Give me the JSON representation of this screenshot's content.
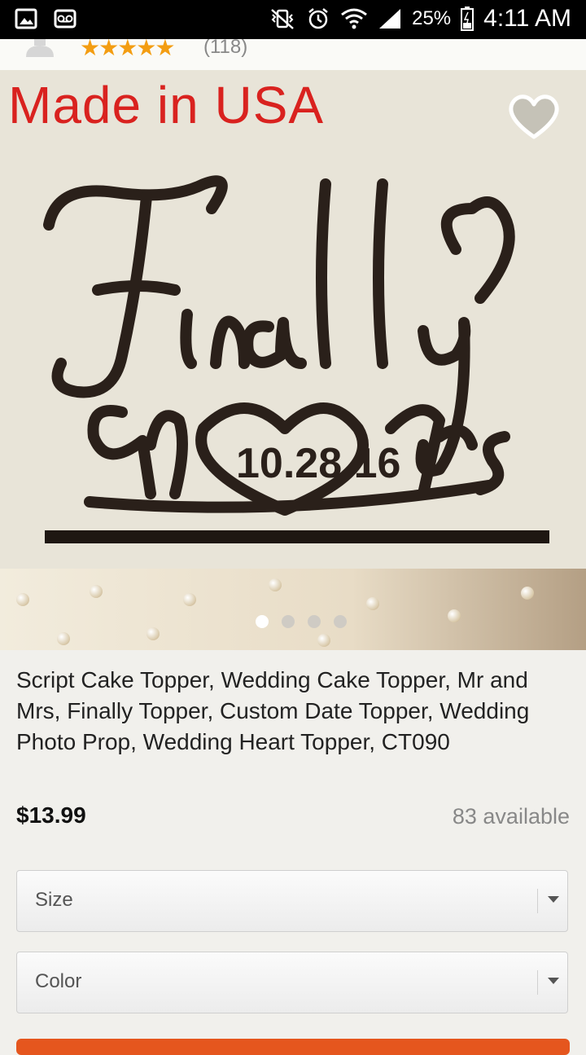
{
  "status_bar": {
    "battery": "25%",
    "time": "4:11 AM"
  },
  "listing": {
    "rating_stars": "★★★★★",
    "rating_count": "(118)",
    "image_banner": "Made in USA",
    "title": "Script Cake Topper, Wedding Cake Topper, Mr and Mrs, Finally Topper, Custom Date Topper, Wedding Photo Prop, Wedding Heart Topper, CT090",
    "price": "$13.99",
    "availability": "83 available",
    "image_count": 4,
    "active_image_index": 0
  },
  "options": {
    "size_label": "Size",
    "color_label": "Color"
  },
  "colors": {
    "accent": "#e5561e",
    "star": "#f39d12",
    "banner_red": "#d9221f"
  }
}
